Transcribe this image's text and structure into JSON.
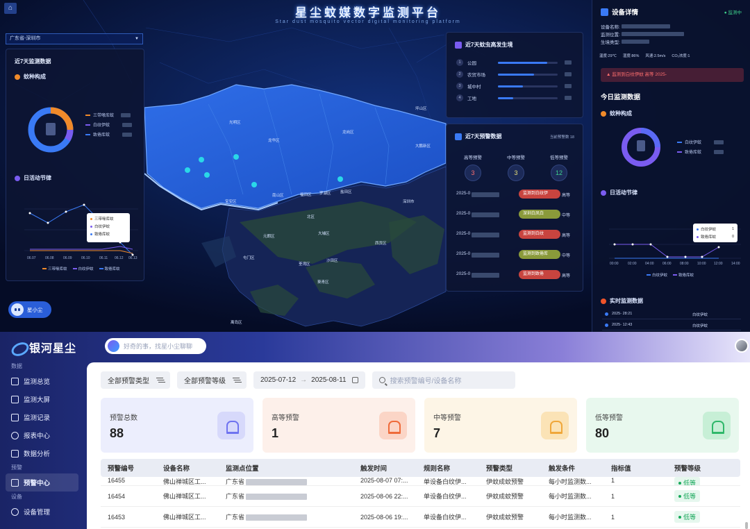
{
  "dashboard": {
    "title": "星尘蚊媒数字监测平台",
    "subtitle": "Star dust mosquito vector digital monitoring platform",
    "region": "广东省-深圳市",
    "left_panel": {
      "title": "近7天监测数据",
      "species_title": "蚊种构成",
      "species_legend": [
        "三带喙库蚊",
        "白纹伊蚊",
        "致倦库蚊"
      ],
      "species_colors": [
        "#f08a2a",
        "#7a5cf0",
        "#3a7af5"
      ],
      "activity_title": "日活动节律",
      "x_ticks": [
        "06.07",
        "06.08",
        "06.09",
        "06.10",
        "06.11",
        "06.12",
        "06.13"
      ],
      "tooltip": [
        "三带喙库蚊",
        "白纹伊蚊",
        "致倦库蚊"
      ],
      "bottom_legend": [
        "三带喙库蚊",
        "白纹伊蚊",
        "致倦库蚊"
      ]
    },
    "env_panel": {
      "title": "近7天蚊虫高发生境",
      "items": [
        {
          "rank": "1",
          "label": "公园",
          "pct": 0.82
        },
        {
          "rank": "2",
          "label": "农贸市场",
          "pct": 0.6
        },
        {
          "rank": "3",
          "label": "城中村",
          "pct": 0.42
        },
        {
          "rank": "4",
          "label": "工地",
          "pct": 0.25
        }
      ]
    },
    "warn_panel": {
      "title": "近7天预警数据",
      "count_label": "当前预警数 18",
      "levels": [
        {
          "label": "高等预警",
          "value": "3",
          "color": "#ff6f6f"
        },
        {
          "label": "中等预警",
          "value": "3",
          "color": "#e8e07a"
        },
        {
          "label": "低等预警",
          "value": "12",
          "color": "#3fd28c"
        }
      ],
      "rows": [
        {
          "time": "2025-0",
          "text": "监测到白纹伊",
          "level": "高等",
          "color": "#c8443f"
        },
        {
          "time": "2025-0",
          "text": "深圳白凤白",
          "level": "中等",
          "color": "#8a9a3a"
        },
        {
          "time": "2025-0",
          "text": "监测到白纹",
          "level": "高等",
          "color": "#c8443f"
        },
        {
          "time": "2025-0",
          "text": "监测到致倦库",
          "level": "中等",
          "color": "#8a9a3a"
        },
        {
          "time": "2025-0",
          "text": "监测到致倦",
          "level": "高等",
          "color": "#c8443f"
        }
      ]
    },
    "map_labels": [
      {
        "text": "光明区"
      },
      {
        "text": "龙岗区"
      },
      {
        "text": "坪山区"
      },
      {
        "text": "大鹏新区"
      },
      {
        "text": "宝安区"
      },
      {
        "text": "龙华区"
      },
      {
        "text": "盐田区"
      },
      {
        "text": "南山区"
      },
      {
        "text": "福田区"
      },
      {
        "text": "罗湖区"
      },
      {
        "text": "元朗区"
      },
      {
        "text": "北区"
      },
      {
        "text": "大埔区"
      },
      {
        "text": "沙田区"
      },
      {
        "text": "荃湾区"
      },
      {
        "text": "屯门区"
      },
      {
        "text": "西贡区"
      },
      {
        "text": "葵青区"
      },
      {
        "text": "离岛区"
      },
      {
        "text": "深圳市"
      }
    ],
    "right_panel": {
      "title": "设备详情",
      "status": "● 监测中",
      "info": [
        "设备名称:",
        "监测位置:",
        "生境类型:"
      ],
      "sensors": [
        "温度:29℃",
        "湿度:86%",
        "风速:2.5m/s",
        "CO₂浓度:1"
      ],
      "alarm": "监测到白纹伊蚊    高等        2025-",
      "today_title": "今日监测数据",
      "species_title": "蚊种构成",
      "species_legend": [
        "白纹伊蚊",
        "致倦库蚊"
      ],
      "activity_title": "日活动节律",
      "x_ticks": [
        "00:00",
        "02:00",
        "04:00",
        "06:00",
        "08:00",
        "10:00",
        "12:00",
        "14:00"
      ],
      "tooltip": [
        {
          "name": "白纹伊蚊",
          "value": "1"
        },
        {
          "name": "致倦库蚊",
          "value": "0"
        }
      ],
      "bottom_legend": [
        "白纹伊蚊",
        "致倦库蚊"
      ],
      "realtime_title": "实时监测数据",
      "realtime_rows": [
        {
          "time": "2025-          28:21",
          "type": "白纹伊蚊"
        },
        {
          "time": "2025-          12:43",
          "type": "白纹伊蚊"
        }
      ]
    },
    "bot_label": "星小尘"
  },
  "admin": {
    "brand": "银河星尘",
    "ask_placeholder": "好奇的事，找星小尘聊聊",
    "nav": [
      {
        "type": "group",
        "label": "数据"
      },
      {
        "type": "item",
        "label": "监测总览",
        "icon": "dashboard-icon"
      },
      {
        "type": "item",
        "label": "监测大屏",
        "icon": "screen-icon"
      },
      {
        "type": "item",
        "label": "监测记录",
        "icon": "record-icon"
      },
      {
        "type": "item",
        "label": "报表中心",
        "icon": "pie-chart-icon"
      },
      {
        "type": "item",
        "label": "数据分析",
        "icon": "analysis-icon"
      },
      {
        "type": "group",
        "label": "预警"
      },
      {
        "type": "item",
        "label": "预警中心",
        "icon": "alarm-icon",
        "active": true
      },
      {
        "type": "group",
        "label": "设备"
      },
      {
        "type": "item",
        "label": "设备管理",
        "icon": "device-icon"
      }
    ],
    "filters": {
      "type": "全部预警类型",
      "level": "全部预警等级",
      "date_start": "2025-07-12",
      "date_sep": "→",
      "date_end": "2025-08-11",
      "search_placeholder": "搜索预警编号/设备名称"
    },
    "cards": [
      {
        "label": "预警总数",
        "value": "88",
        "bg": "#eceefd",
        "accent": "#6f73f0",
        "badge": "#d7d9fb"
      },
      {
        "label": "高等预警",
        "value": "1",
        "bg": "#fdf0ea",
        "accent": "#ef6b3a",
        "badge": "#fbd5c6"
      },
      {
        "label": "中等预警",
        "value": "7",
        "bg": "#fdf5e6",
        "accent": "#f0a73a",
        "badge": "#fbe3b6"
      },
      {
        "label": "低等预警",
        "value": "80",
        "bg": "#e8f8ee",
        "accent": "#2fb86a",
        "badge": "#c7efd6"
      }
    ],
    "table": {
      "headers": [
        "预警编号",
        "设备名称",
        "监测点位置",
        "触发时间",
        "规则名称",
        "预警类型",
        "触发条件",
        "指标值",
        "预警等级"
      ],
      "rows": [
        [
          "16455",
          "佛山禅城区工...",
          "广东省",
          "2025-08-07 07:...",
          "单设备白纹伊...",
          "伊蚊成蚊预警",
          "每小时监测数...",
          "1",
          "低等"
        ],
        [
          "16454",
          "佛山禅城区工...",
          "广东省",
          "2025-08-06 22:...",
          "单设备白纹伊...",
          "伊蚊成蚊预警",
          "每小时监测数...",
          "1",
          "低等"
        ],
        [
          "16453",
          "佛山禅城区工...",
          "广东省",
          "2025-08-06 19:...",
          "单设备白纹伊...",
          "伊蚊成蚊预警",
          "每小时监测数...",
          "1",
          "低等"
        ]
      ]
    }
  }
}
